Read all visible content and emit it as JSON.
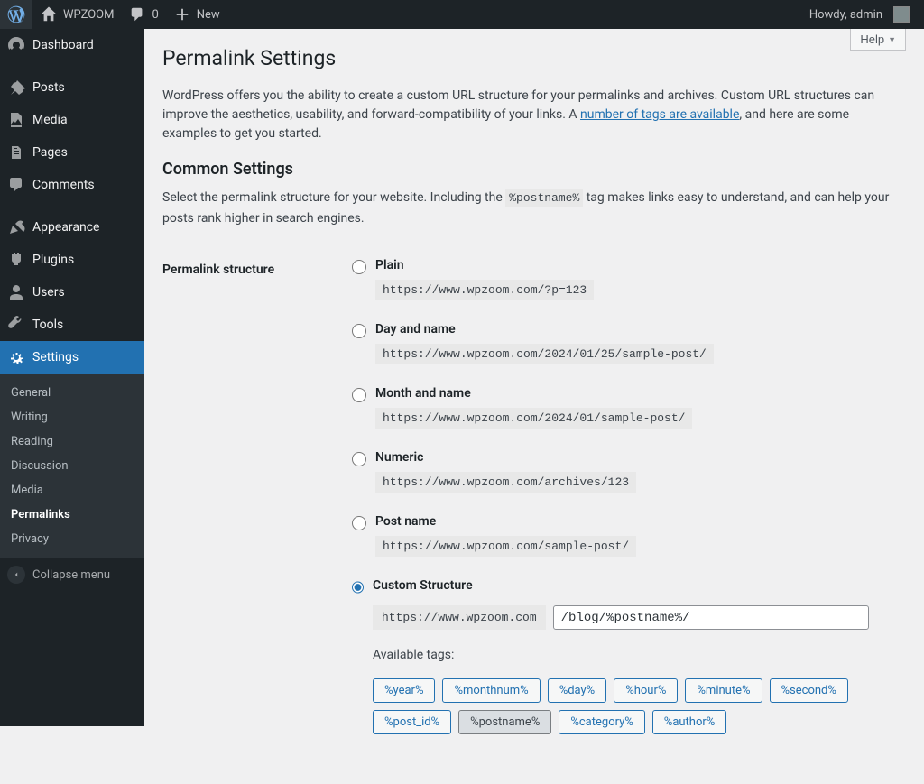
{
  "adminBar": {
    "siteName": "WPZOOM",
    "commentCount": "0",
    "newLabel": "New",
    "howdy": "Howdy, admin"
  },
  "sidebar": {
    "items": [
      {
        "label": "Dashboard",
        "icon": "dashboard"
      },
      {
        "label": "Posts",
        "icon": "pin"
      },
      {
        "label": "Media",
        "icon": "media"
      },
      {
        "label": "Pages",
        "icon": "pages"
      },
      {
        "label": "Comments",
        "icon": "comment"
      },
      {
        "label": "Appearance",
        "icon": "appearance"
      },
      {
        "label": "Plugins",
        "icon": "plugin"
      },
      {
        "label": "Users",
        "icon": "user"
      },
      {
        "label": "Tools",
        "icon": "tool"
      },
      {
        "label": "Settings",
        "icon": "settings"
      }
    ],
    "subItems": [
      "General",
      "Writing",
      "Reading",
      "Discussion",
      "Media",
      "Permalinks",
      "Privacy"
    ],
    "collapseLabel": "Collapse menu"
  },
  "page": {
    "helpLabel": "Help",
    "title": "Permalink Settings",
    "introA": "WordPress offers you the ability to create a custom URL structure for your permalinks and archives. Custom URL structures can improve the aesthetics, usability, and forward-compatibility of your links. A ",
    "introLink": "number of tags are available",
    "introB": ", and here are some examples to get you started.",
    "commonHeading": "Common Settings",
    "commonDescA": "Select the permalink structure for your website. Including the ",
    "commonDescCode": "%postname%",
    "commonDescB": " tag makes links easy to understand, and can help your posts rank higher in search engines.",
    "structureLabel": "Permalink structure",
    "options": [
      {
        "label": "Plain",
        "example": "https://www.wpzoom.com/?p=123"
      },
      {
        "label": "Day and name",
        "example": "https://www.wpzoom.com/2024/01/25/sample-post/"
      },
      {
        "label": "Month and name",
        "example": "https://www.wpzoom.com/2024/01/sample-post/"
      },
      {
        "label": "Numeric",
        "example": "https://www.wpzoom.com/archives/123"
      },
      {
        "label": "Post name",
        "example": "https://www.wpzoom.com/sample-post/"
      }
    ],
    "custom": {
      "label": "Custom Structure",
      "prefix": "https://www.wpzoom.com",
      "value": "/blog/%postname%/",
      "availableLabel": "Available tags:",
      "tags": [
        "%year%",
        "%monthnum%",
        "%day%",
        "%hour%",
        "%minute%",
        "%second%",
        "%post_id%",
        "%postname%",
        "%category%",
        "%author%"
      ],
      "pressedTag": "%postname%"
    }
  }
}
